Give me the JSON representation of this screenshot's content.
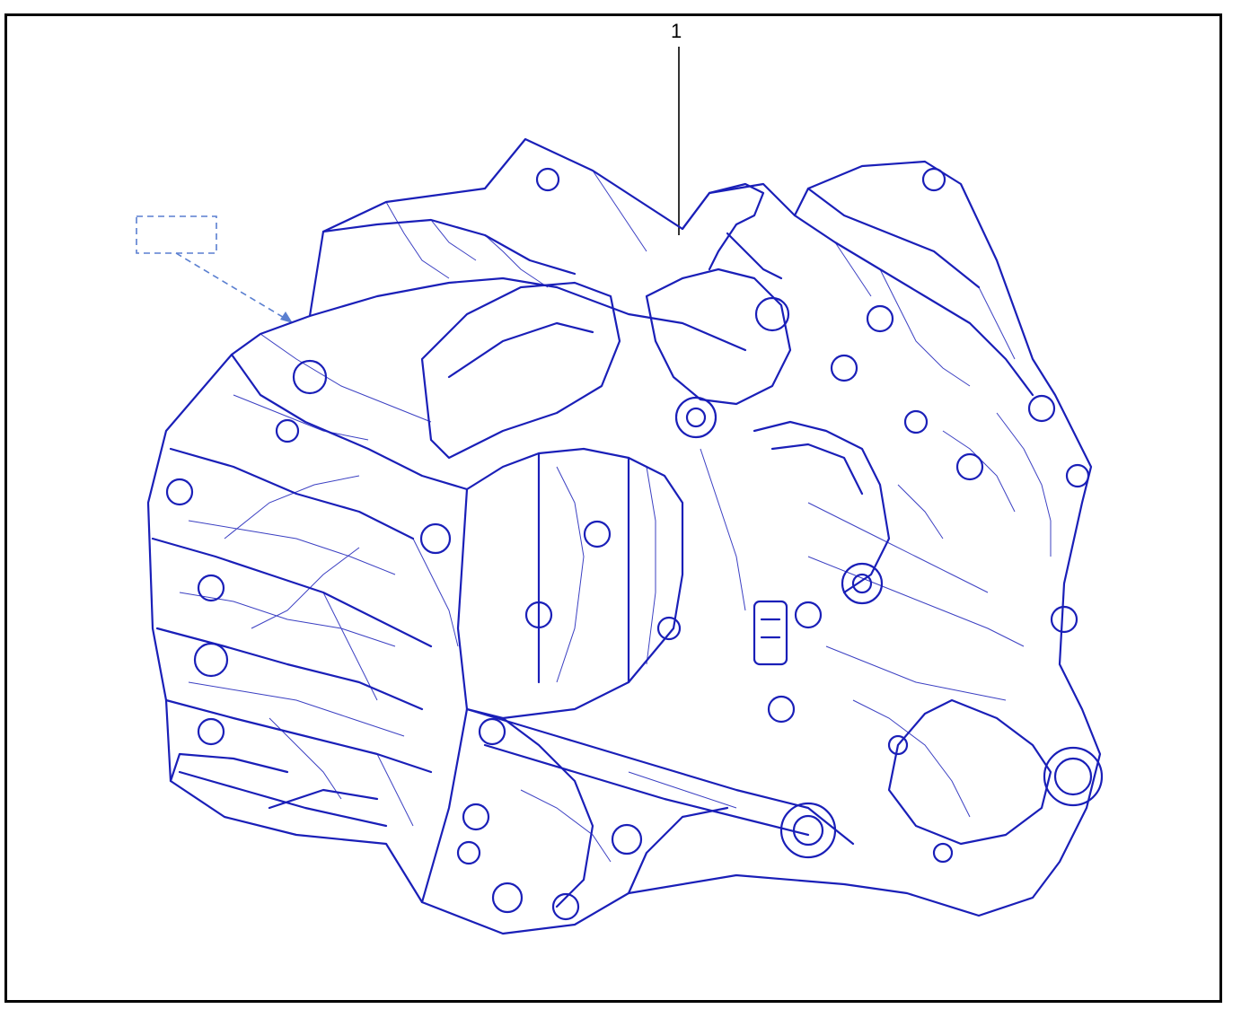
{
  "diagram": {
    "callouts": [
      {
        "label": "1",
        "part": "transmission-assembly"
      }
    ],
    "colors": {
      "frame": "#000000",
      "linework": "#1a1fb8",
      "leader": "#000000",
      "placeholder": "#5a7fd0"
    }
  }
}
